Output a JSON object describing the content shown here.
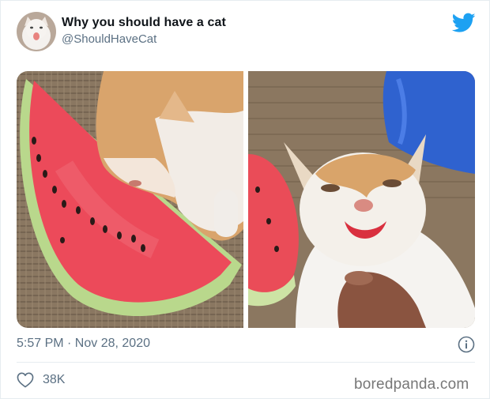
{
  "tweet": {
    "display_name": "Why you should have a cat",
    "handle": "@ShouldHaveCat",
    "timestamp": "5:57 PM · Nov 28, 2020",
    "like_count": "38K"
  },
  "images": [
    {
      "name": "cat-licking-watermelon"
    },
    {
      "name": "cat-with-red-mouth"
    }
  ],
  "icons": {
    "brand": "twitter-bird-icon",
    "info": "info-icon",
    "like": "heart-icon"
  },
  "watermark": "boredpanda.com",
  "colors": {
    "twitter_blue": "#1da1f2",
    "secondary_text": "#5b7083",
    "divider": "#e6ecf0"
  }
}
